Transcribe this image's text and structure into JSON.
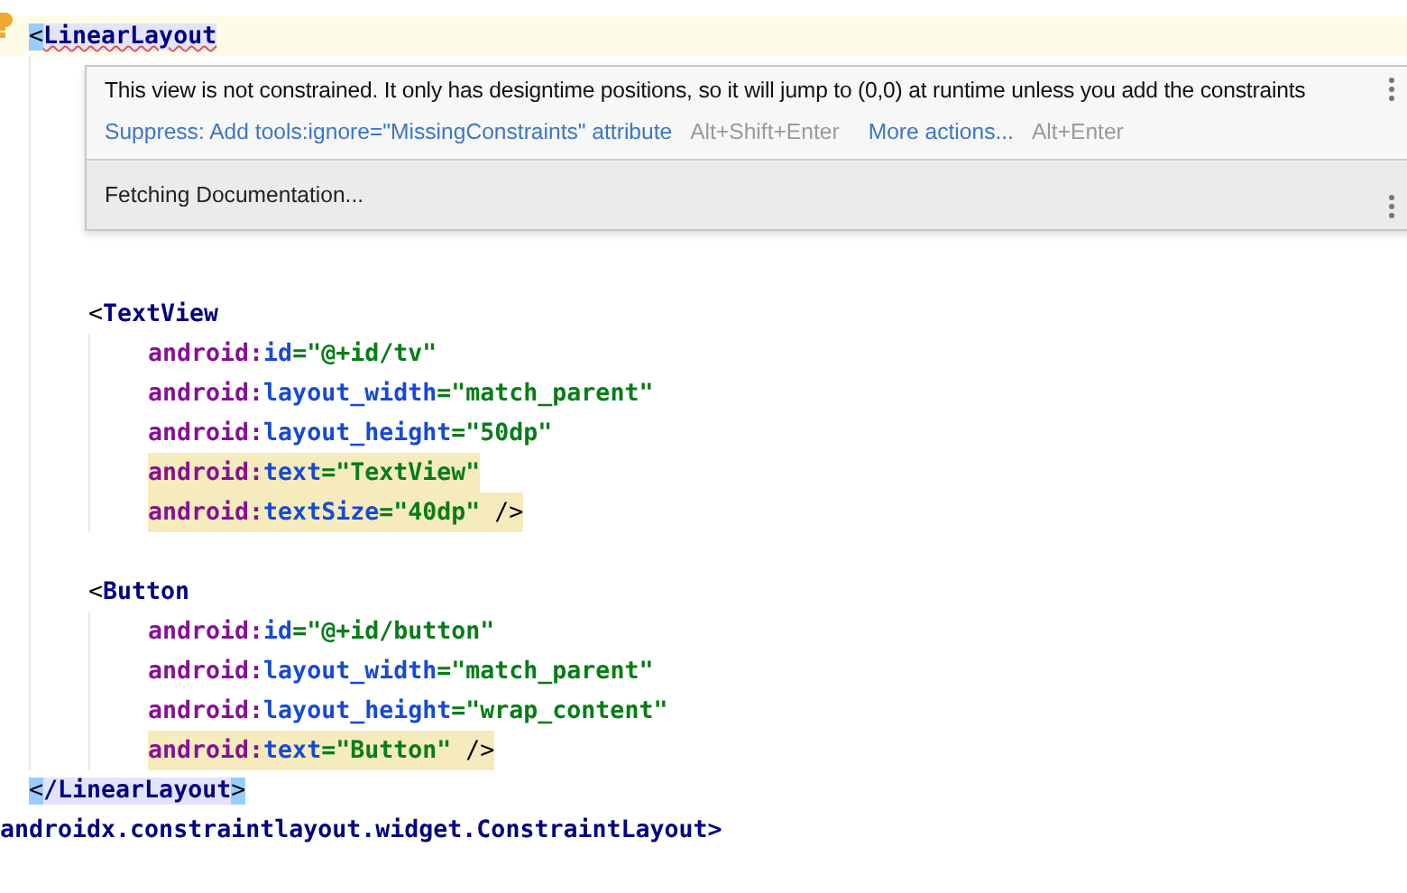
{
  "editor": {
    "lines": [
      {
        "kind": "code",
        "current": true,
        "tokens": [
          {
            "text": "<",
            "kind": "bracket-match"
          },
          {
            "text": "LinearLayout",
            "kind": "tag-error"
          }
        ],
        "children": [
          {
            "kind": "blank"
          },
          {
            "kind": "blank"
          },
          {
            "kind": "blank"
          },
          {
            "kind": "blank"
          },
          {
            "kind": "blank"
          },
          {
            "kind": "blank"
          },
          {
            "kind": "code",
            "tokens": [
              {
                "text": "<",
                "kind": "plain"
              },
              {
                "text": "TextView",
                "kind": "tag"
              }
            ],
            "children": [
              {
                "kind": "code",
                "highlighted": false,
                "tokens": [
                  {
                    "text": "android:",
                    "kind": "ns"
                  },
                  {
                    "text": "id",
                    "kind": "attr"
                  },
                  {
                    "text": "=\"@+id/tv\"",
                    "kind": "value"
                  }
                ]
              },
              {
                "kind": "code",
                "highlighted": false,
                "tokens": [
                  {
                    "text": "android:",
                    "kind": "ns"
                  },
                  {
                    "text": "layout_width",
                    "kind": "attr"
                  },
                  {
                    "text": "=\"match_parent\"",
                    "kind": "value"
                  }
                ]
              },
              {
                "kind": "code",
                "highlighted": false,
                "tokens": [
                  {
                    "text": "android:",
                    "kind": "ns"
                  },
                  {
                    "text": "layout_height",
                    "kind": "attr"
                  },
                  {
                    "text": "=\"50dp\"",
                    "kind": "value"
                  }
                ]
              },
              {
                "kind": "code",
                "highlighted": true,
                "tokens": [
                  {
                    "text": "android:",
                    "kind": "ns"
                  },
                  {
                    "text": "text",
                    "kind": "attr"
                  },
                  {
                    "text": "=\"TextView\"",
                    "kind": "value"
                  }
                ]
              },
              {
                "kind": "code",
                "highlighted": true,
                "tokens": [
                  {
                    "text": "android:",
                    "kind": "ns"
                  },
                  {
                    "text": "textSize",
                    "kind": "attr"
                  },
                  {
                    "text": "=\"40dp\"",
                    "kind": "value"
                  }
                ],
                "suffix": " />"
              }
            ]
          },
          {
            "kind": "blank"
          },
          {
            "kind": "code",
            "tokens": [
              {
                "text": "<",
                "kind": "plain"
              },
              {
                "text": "Button",
                "kind": "tag"
              }
            ],
            "children": [
              {
                "kind": "code",
                "highlighted": false,
                "tokens": [
                  {
                    "text": "android:",
                    "kind": "ns"
                  },
                  {
                    "text": "id",
                    "kind": "attr"
                  },
                  {
                    "text": "=\"@+id/button\"",
                    "kind": "value"
                  }
                ]
              },
              {
                "kind": "code",
                "highlighted": false,
                "tokens": [
                  {
                    "text": "android:",
                    "kind": "ns"
                  },
                  {
                    "text": "layout_width",
                    "kind": "attr"
                  },
                  {
                    "text": "=\"match_parent\"",
                    "kind": "value"
                  }
                ]
              },
              {
                "kind": "code",
                "highlighted": false,
                "tokens": [
                  {
                    "text": "android:",
                    "kind": "ns"
                  },
                  {
                    "text": "layout_height",
                    "kind": "attr"
                  },
                  {
                    "text": "=\"wrap_content\"",
                    "kind": "value"
                  }
                ]
              },
              {
                "kind": "code",
                "highlighted": true,
                "tokens": [
                  {
                    "text": "android:",
                    "kind": "ns"
                  },
                  {
                    "text": "text",
                    "kind": "attr"
                  },
                  {
                    "text": "=\"Button\"",
                    "kind": "value"
                  }
                ],
                "suffix": " />"
              }
            ]
          }
        ]
      },
      {
        "kind": "code",
        "tokens": [
          {
            "text": "<",
            "kind": "bracket-match"
          },
          {
            "text": "/LinearLayout",
            "kind": "tag-match"
          },
          {
            "text": ">",
            "kind": "bracket-match"
          }
        ]
      },
      {
        "kind": "outer",
        "tokens": [
          {
            "text": "androidx.constraintlayout.widget.ConstraintLayout>",
            "kind": "tag"
          }
        ]
      }
    ]
  },
  "popup": {
    "message": "This view is not constrained. It only has designtime positions, so it will jump to (0,0) at runtime unless you add the constraints",
    "actions": [
      {
        "label": "Suppress: Add tools:ignore=\"MissingConstraints\" attribute",
        "shortcut": "Alt+Shift+Enter"
      },
      {
        "label": "More actions...",
        "shortcut": "Alt+Enter"
      }
    ],
    "documentation": "Fetching Documentation..."
  }
}
